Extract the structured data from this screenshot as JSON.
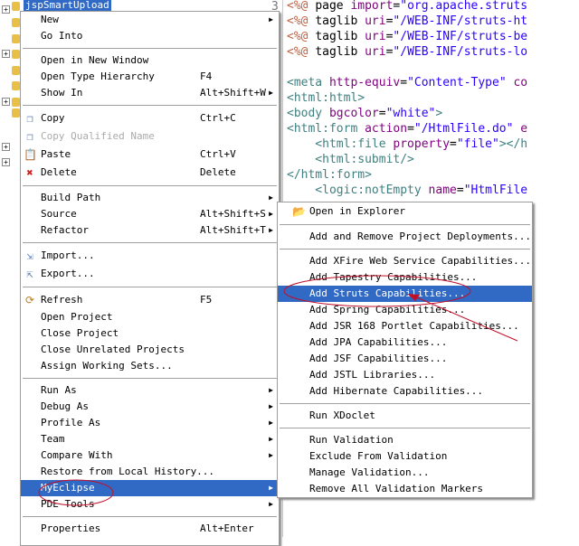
{
  "project": {
    "name": "jspSmartUpload"
  },
  "editor": {
    "line_number": "3",
    "lines": [
      [
        [
          "dir",
          "<%@ "
        ],
        [
          "pl",
          "page "
        ],
        [
          "att",
          "import"
        ],
        [
          "pl",
          "="
        ],
        [
          "val",
          "\"org.apache.struts"
        ]
      ],
      [
        [
          "dir",
          "<%@ "
        ],
        [
          "pl",
          "taglib "
        ],
        [
          "att",
          "uri"
        ],
        [
          "pl",
          "="
        ],
        [
          "val",
          "\"/WEB-INF/struts-ht"
        ]
      ],
      [
        [
          "dir",
          "<%@ "
        ],
        [
          "pl",
          "taglib "
        ],
        [
          "att",
          "uri"
        ],
        [
          "pl",
          "="
        ],
        [
          "val",
          "\"/WEB-INF/struts-be"
        ]
      ],
      [
        [
          "dir",
          "<%@ "
        ],
        [
          "pl",
          "taglib "
        ],
        [
          "att",
          "uri"
        ],
        [
          "pl",
          "="
        ],
        [
          "val",
          "\"/WEB-INF/struts-lo"
        ]
      ],
      [],
      [
        [
          "tag",
          "<meta "
        ],
        [
          "att",
          "http-equiv"
        ],
        [
          "pl",
          "="
        ],
        [
          "val",
          "\"Content-Type\""
        ],
        [
          "att",
          " co"
        ]
      ],
      [
        [
          "tag",
          "<html:html>"
        ]
      ],
      [
        [
          "tag",
          "<body "
        ],
        [
          "att",
          "bgcolor"
        ],
        [
          "pl",
          "="
        ],
        [
          "val",
          "\"white\""
        ],
        [
          "tag",
          ">"
        ]
      ],
      [
        [
          "tag",
          "<html:form "
        ],
        [
          "att",
          "action"
        ],
        [
          "pl",
          "="
        ],
        [
          "val",
          "\"/HtmlFile.do\""
        ],
        [
          "att",
          " e"
        ]
      ],
      [
        [
          "tag",
          "    <html:file "
        ],
        [
          "att",
          "property"
        ],
        [
          "pl",
          "="
        ],
        [
          "val",
          "\"file\""
        ],
        [
          "tag",
          "></h"
        ]
      ],
      [
        [
          "tag",
          "    <html:submit/>"
        ]
      ],
      [
        [
          "tag",
          "</html:form>"
        ]
      ],
      [
        [
          "tag",
          "    <logic:notEmpty "
        ],
        [
          "att",
          "name"
        ],
        [
          "pl",
          "="
        ],
        [
          "val",
          "\"HtmlFile"
        ]
      ]
    ]
  },
  "context_menu": {
    "items": [
      {
        "label": "New",
        "submenu": true
      },
      {
        "label": "Go Into"
      },
      {
        "sep": true
      },
      {
        "label": "Open in New Window"
      },
      {
        "label": "Open Type Hierarchy",
        "shortcut": "F4"
      },
      {
        "label": "Show In",
        "shortcut": "Alt+Shift+W",
        "submenu": true
      },
      {
        "sep": true
      },
      {
        "label": "Copy",
        "shortcut": "Ctrl+C",
        "icon": "copy-icon"
      },
      {
        "label": "Copy Qualified Name",
        "icon": "copy-qualified-icon",
        "disabled": true
      },
      {
        "label": "Paste",
        "shortcut": "Ctrl+V",
        "icon": "paste-icon"
      },
      {
        "label": "Delete",
        "shortcut": "Delete",
        "icon": "delete-icon"
      },
      {
        "sep": true
      },
      {
        "label": "Build Path",
        "submenu": true
      },
      {
        "label": "Source",
        "shortcut": "Alt+Shift+S",
        "submenu": true
      },
      {
        "label": "Refactor",
        "shortcut": "Alt+Shift+T",
        "submenu": true
      },
      {
        "sep": true
      },
      {
        "label": "Import...",
        "icon": "import-icon"
      },
      {
        "label": "Export...",
        "icon": "export-icon"
      },
      {
        "sep": true
      },
      {
        "label": "Refresh",
        "shortcut": "F5",
        "icon": "refresh-icon"
      },
      {
        "label": "Open Project"
      },
      {
        "label": "Close Project"
      },
      {
        "label": "Close Unrelated Projects"
      },
      {
        "label": "Assign Working Sets..."
      },
      {
        "sep": true
      },
      {
        "label": "Run As",
        "submenu": true
      },
      {
        "label": "Debug As",
        "submenu": true
      },
      {
        "label": "Profile As",
        "submenu": true
      },
      {
        "label": "Team",
        "submenu": true
      },
      {
        "label": "Compare With",
        "submenu": true
      },
      {
        "label": "Restore from Local History..."
      },
      {
        "label": "MyEclipse",
        "submenu": true,
        "selected": true
      },
      {
        "label": "PDE Tools",
        "submenu": true
      },
      {
        "sep": true
      },
      {
        "label": "Properties",
        "shortcut": "Alt+Enter"
      }
    ]
  },
  "myeclipse_submenu": {
    "items": [
      {
        "label": "Open in Explorer",
        "icon": "folder-open-icon"
      },
      {
        "sep": true
      },
      {
        "label": "Add and Remove Project Deployments..."
      },
      {
        "sep": true
      },
      {
        "label": "Add XFire Web Service Capabilities..."
      },
      {
        "label": "Add Tapestry Capabilities..."
      },
      {
        "label": "Add Struts Capabilities...",
        "selected": true
      },
      {
        "label": "Add Spring Capabilities..."
      },
      {
        "label": "Add JSR 168 Portlet Capabilities..."
      },
      {
        "label": "Add JPA Capabilities..."
      },
      {
        "label": "Add JSF Capabilities..."
      },
      {
        "label": "Add JSTL Libraries..."
      },
      {
        "label": "Add Hibernate Capabilities..."
      },
      {
        "sep": true
      },
      {
        "label": "Run XDoclet"
      },
      {
        "sep": true
      },
      {
        "label": "Run Validation"
      },
      {
        "label": "Exclude From Validation"
      },
      {
        "label": "Manage Validation..."
      },
      {
        "label": "Remove All Validation Markers"
      }
    ]
  },
  "colors": {
    "selection": "#316ac5",
    "annotation": "#c0102a"
  }
}
